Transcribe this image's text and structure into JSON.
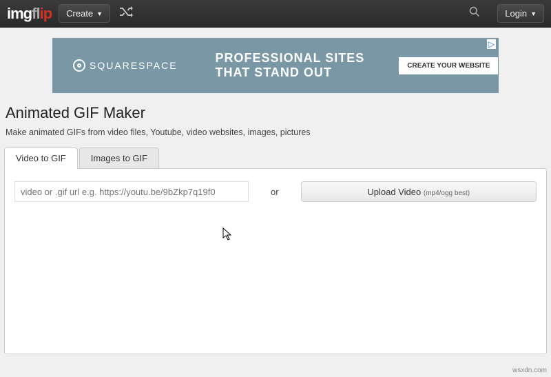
{
  "nav": {
    "logo_a": "img",
    "logo_b": "fl",
    "logo_c": "ip",
    "create": "Create",
    "login": "Login"
  },
  "ad": {
    "brand": "SQUARESPACE",
    "line1": "PROFESSIONAL SITES",
    "line2": "THAT STAND OUT",
    "cta": "CREATE YOUR WEBSITE"
  },
  "page": {
    "title": "Animated GIF Maker",
    "subtitle": "Make animated GIFs from video files, Youtube, video websites, images, pictures"
  },
  "tabs": {
    "video": "Video to GIF",
    "images": "Images to GIF"
  },
  "form": {
    "url_placeholder": "video or .gif url e.g. https://youtu.be/9bZkp7q19f0",
    "or": "or",
    "upload": "Upload Video",
    "upload_hint": "(mp4/ogg best)"
  },
  "watermark": "wsxdn.com"
}
